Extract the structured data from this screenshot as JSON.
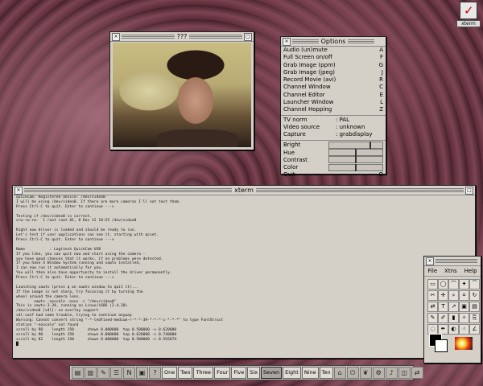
{
  "camera_window": {
    "title": "???"
  },
  "options_window": {
    "title": "Options",
    "menu": [
      {
        "label": "Audio (un)mute",
        "key": "A"
      },
      {
        "label": "Full Screen on/off",
        "key": "F"
      },
      {
        "label": "Grab Image (ppm)",
        "key": "G"
      },
      {
        "label": "Grab Image (jpeg)",
        "key": "J"
      },
      {
        "label": "Record Movie (avi)",
        "key": "R"
      },
      {
        "label": "Channel Window",
        "key": "C"
      },
      {
        "label": "Channel Editor",
        "key": "E"
      },
      {
        "label": "Launcher Window",
        "key": "L"
      },
      {
        "label": "Channel Hopping",
        "key": "Z"
      }
    ],
    "settings": [
      {
        "label": "TV norm",
        "value": ": PAL"
      },
      {
        "label": "Video source",
        "value": ": unknown"
      },
      {
        "label": "Capture",
        "value": ": grabdisplay"
      }
    ],
    "sliders": [
      {
        "label": "Bright",
        "level": 0.78
      },
      {
        "label": "Hue",
        "level": 0.5
      },
      {
        "label": "Contrast",
        "level": 0.5
      },
      {
        "label": "Color",
        "level": 0.5
      }
    ],
    "quit": {
      "label": "Quit",
      "key": "Q"
    }
  },
  "xterm_window": {
    "title": "xterm",
    "lines": [
      "quickcam: Registered device: /dev/video0",
      "I will be using /dev/video0. If there are more cameras I'll not test them.",
      "Press Ctrl-C to quit. Enter to continue --->",
      "",
      "Testing if /dev/video0 is correct.",
      "crw-rw-rw-  1 root root 81, 0 Dec 12 18:55 /dev/video0",
      "",
      "Right now driver is loaded and should be ready to run.",
      "Let's test if user applications can see it, starting with qcset.",
      "Press Ctrl-C to quit. Enter to continue --->",
      "",
      "Name           : Logitech QuickCam USB",
      "If you like, you can quit now and start using the camera -",
      "you have good chances that it works, if no problems were detected.",
      "If you have X Window System running and xawtv installed,",
      "I can now run it automatically for you.",
      "You will then also have opportunity to install the driver permanently.",
      "Press Ctrl-C to quit. Enter to continue --->",
      "",
      "Launching xawtv (press q on xawtv window to quit it)...",
      "If the image is not sharp, try focusing it by turning the",
      "wheel around the camera lens.",
      "        xawtv -noscale -noxv -c \"/dev/video0\"",
      "This is xawtv-3.34, running on Linux/i686 (2.4.20)",
      "/dev/video0 [v4l]: no overlay support",
      "v4l-conf had some trouble, trying to continue anyway",
      "Warning: Cannot convert string \"-*-ledfixed-medium-r-*-*-39-*-*-*-c-*-*-*\" to type FontStruct",
      "station \"-noscale\" not found",
      "scroll by 90    length 150      shown 0.000000  top 0.500000 -> 0.620000",
      "scroll by 90    length 150      shown 0.000000  top 0.620000 -> 0.740000",
      "scroll by 82    length 150      shown 0.000000  top 0.500000 -> 0.592674",
      "█"
    ]
  },
  "gimp_toolbox": {
    "menu": [
      "File",
      "Xtns",
      "Help"
    ],
    "tools": [
      {
        "name": "rect-select-icon",
        "glyph": "▭"
      },
      {
        "name": "ellipse-select-icon",
        "glyph": "◯"
      },
      {
        "name": "lasso-icon",
        "glyph": "⌒"
      },
      {
        "name": "magic-wand-icon",
        "glyph": "✦"
      },
      {
        "name": "bezier-icon",
        "glyph": "⁀"
      },
      {
        "name": "scissors-icon",
        "glyph": "✂"
      },
      {
        "name": "move-icon",
        "glyph": "✛"
      },
      {
        "name": "magnify-icon",
        "glyph": "⌕"
      },
      {
        "name": "crop-icon",
        "glyph": "⌗"
      },
      {
        "name": "transform-icon",
        "glyph": "↻"
      },
      {
        "name": "flip-icon",
        "glyph": "⇄"
      },
      {
        "name": "text-icon",
        "glyph": "T"
      },
      {
        "name": "color-picker-icon",
        "glyph": "↗"
      },
      {
        "name": "bucket-fill-icon",
        "glyph": "▣"
      },
      {
        "name": "blend-icon",
        "glyph": "▤"
      },
      {
        "name": "pencil-icon",
        "glyph": "✎"
      },
      {
        "name": "paintbrush-icon",
        "glyph": "✐"
      },
      {
        "name": "eraser-icon",
        "glyph": "▮"
      },
      {
        "name": "airbrush-icon",
        "glyph": "✧"
      },
      {
        "name": "clone-icon",
        "glyph": "⎘"
      },
      {
        "name": "convolve-icon",
        "glyph": "◌"
      },
      {
        "name": "ink-icon",
        "glyph": "✒"
      },
      {
        "name": "dodge-icon",
        "glyph": "◐"
      },
      {
        "name": "smudge-icon",
        "glyph": "☝"
      },
      {
        "name": "measure-icon",
        "glyph": "∠"
      }
    ]
  },
  "desktop_icons": [
    {
      "label": "xterm"
    }
  ],
  "taskbar": {
    "left_icons": [
      "terminal-icon",
      "chest-icon",
      "paint-icon",
      "editor-icon",
      "netscape-icon",
      "monitor-icon",
      "help-icon"
    ],
    "desktops": [
      "One",
      "Two",
      "Three",
      "Four",
      "Five",
      "Six",
      "Seven",
      "Eight",
      "Nine",
      "Ten"
    ],
    "active_desktop": "Seven",
    "right_icons": [
      "home-icon",
      "power-icon",
      "gimp-icon",
      "settings-icon",
      "sound-icon",
      "package-icon",
      "network-icon"
    ]
  }
}
